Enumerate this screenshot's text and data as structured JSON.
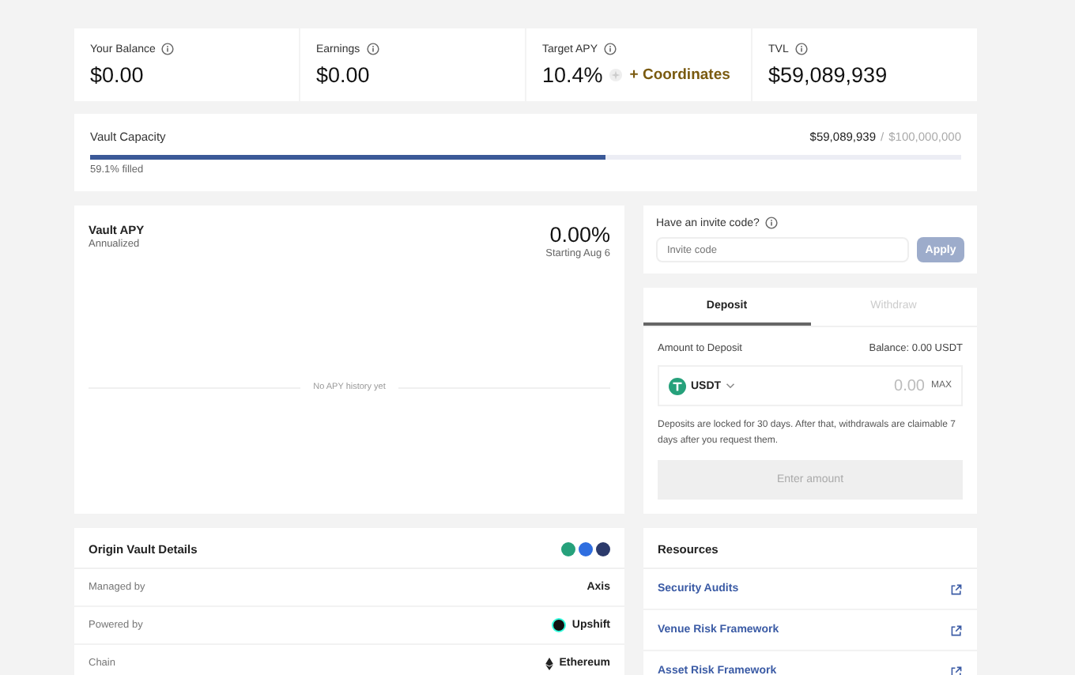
{
  "stats": [
    {
      "label": "Your Balance",
      "value": "$0.00"
    },
    {
      "label": "Earnings",
      "value": "$0.00"
    },
    {
      "label": "Target APY",
      "value": "10.4%",
      "bonus": "+ Coordinates"
    },
    {
      "label": "TVL",
      "value": "$59,089,939"
    }
  ],
  "capacity": {
    "title": "Vault Capacity",
    "current": "$59,089,939",
    "separator": "/",
    "max": "$100,000,000",
    "level": 0.591,
    "filled": "59.1% filled"
  },
  "apy": {
    "title": "Vault APY",
    "subtitle": "Annualized",
    "value": "0.00%",
    "since": "Starting Aug 6",
    "empty": "No APY history yet"
  },
  "invite": {
    "label": "Have an invite code?",
    "placeholder": "Invite code",
    "button": "Apply",
    "disabled": true
  },
  "tabs": [
    {
      "label": "Deposit",
      "selected": true
    },
    {
      "label": "Withdraw",
      "selected": false
    }
  ],
  "deposit": {
    "label": "Amount to Deposit",
    "balance": "Balance: 0.00 USDT",
    "token": "USDT",
    "amount": "0.00",
    "max": "MAX",
    "note": "Deposits are locked for 30 days. After that, withdrawals are claimable 7 days after you request them.",
    "button": "Enter amount",
    "disabled": true
  },
  "details": {
    "title": "Origin Vault Details",
    "tokens": [
      {
        "color": "#26a17b"
      },
      {
        "color": "#2f6ee0"
      },
      {
        "color": "#2c3a6b"
      }
    ],
    "rows": [
      {
        "label": "Managed by",
        "value": "Axis",
        "kind": "plain"
      },
      {
        "label": "Powered by",
        "value": "Upshift",
        "kind": "logo"
      },
      {
        "label": "Chain",
        "value": "Ethereum",
        "kind": "chain"
      }
    ]
  },
  "resources": {
    "title": "Resources",
    "links": [
      {
        "label": "Security Audits"
      },
      {
        "label": "Venue Risk Framework"
      },
      {
        "label": "Asset Risk Framework"
      }
    ]
  }
}
